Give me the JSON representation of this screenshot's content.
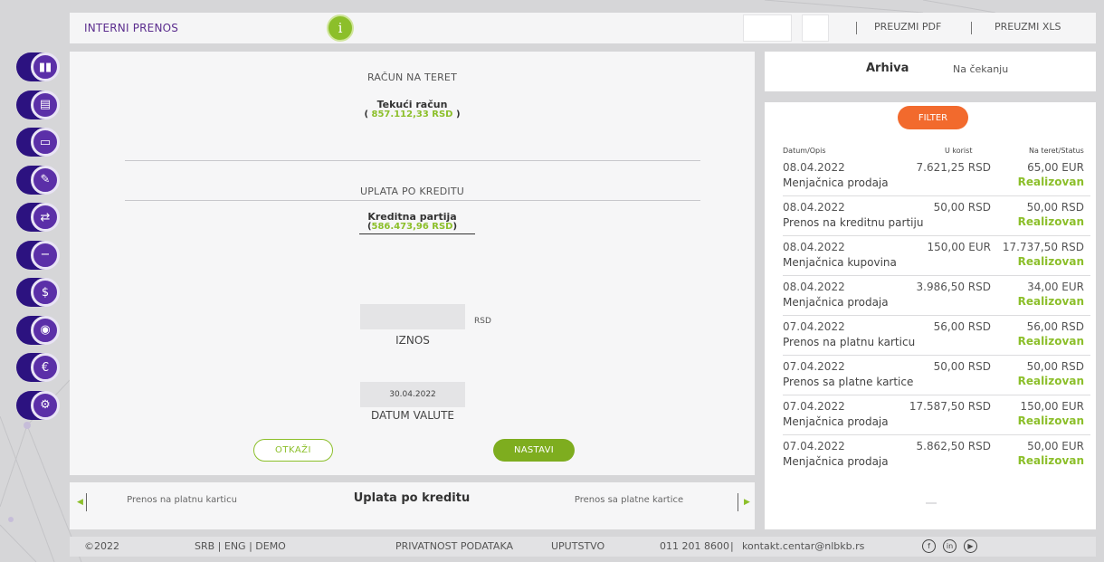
{
  "header": {
    "title": "INTERNI PRENOS",
    "info_icon": "i",
    "download_pdf": "PREUZMI PDF",
    "download_xls": "PREUZMI XLS"
  },
  "sidebar": {
    "items": [
      {
        "icon": "chart-icon",
        "glyph": "▮▮"
      },
      {
        "icon": "document-icon",
        "glyph": "▤"
      },
      {
        "icon": "card-icon",
        "glyph": "▭"
      },
      {
        "icon": "signature-icon",
        "glyph": "✎"
      },
      {
        "icon": "transfer-icon",
        "glyph": "⇄"
      },
      {
        "icon": "minus-icon",
        "glyph": "−"
      },
      {
        "icon": "dollar-icon",
        "glyph": "$"
      },
      {
        "icon": "location-icon",
        "glyph": "◉"
      },
      {
        "icon": "euro-icon",
        "glyph": "€"
      },
      {
        "icon": "gear-icon",
        "glyph": "⚙"
      }
    ]
  },
  "form": {
    "debit_label": "RAČUN NA TERET",
    "debit_account_name": "Tekući račun",
    "debit_account_amount": "857.112,33 RSD",
    "payment_label": "UPLATA PO KREDITU",
    "credit_account_name": "Kreditna partija",
    "credit_account_amount": "586.473,96 RSD",
    "amount_value": "",
    "amount_currency": "RSD",
    "amount_label": "IZNOS",
    "date_value": "30.04.2022",
    "date_label": "DATUM VALUTE",
    "cancel_label": "OTKAŽI",
    "continue_label": "NASTAVI"
  },
  "carousel": {
    "prev": "Prenos na platnu karticu",
    "current": "Uplata po kreditu",
    "next": "Prenos sa platne kartice"
  },
  "archive": {
    "tabs": [
      "Arhiva",
      "Na čekanju"
    ],
    "filter_label": "FILTER",
    "columns": [
      "Datum/Opis",
      "U korist",
      "Na teret/Status"
    ],
    "rows": [
      {
        "date": "08.04.2022",
        "desc": "Menjačnica prodaja",
        "credit": "7.621,25 RSD",
        "debit": "65,00 EUR",
        "status": "Realizovan"
      },
      {
        "date": "08.04.2022",
        "desc": "Prenos na kreditnu partiju",
        "credit": "50,00 RSD",
        "debit": "50,00 RSD",
        "status": "Realizovan"
      },
      {
        "date": "08.04.2022",
        "desc": "Menjačnica kupovina",
        "credit": "150,00 EUR",
        "debit": "17.737,50 RSD",
        "status": "Realizovan"
      },
      {
        "date": "08.04.2022",
        "desc": "Menjačnica prodaja",
        "credit": "3.986,50 RSD",
        "debit": "34,00 EUR",
        "status": "Realizovan"
      },
      {
        "date": "07.04.2022",
        "desc": "Prenos na platnu karticu",
        "credit": "56,00 RSD",
        "debit": "56,00 RSD",
        "status": "Realizovan"
      },
      {
        "date": "07.04.2022",
        "desc": "Prenos sa platne kartice",
        "credit": "50,00 RSD",
        "debit": "50,00 RSD",
        "status": "Realizovan"
      },
      {
        "date": "07.04.2022",
        "desc": "Menjačnica prodaja",
        "credit": "17.587,50 RSD",
        "debit": "150,00 EUR",
        "status": "Realizovan"
      },
      {
        "date": "07.04.2022",
        "desc": "Menjačnica prodaja",
        "credit": "5.862,50 RSD",
        "debit": "50,00 EUR",
        "status": "Realizovan"
      }
    ]
  },
  "footer": {
    "copyright": "©2022",
    "lang": "SRB | ENG | DEMO",
    "privacy": "PRIVATNOST PODATAKA",
    "guide": "UPUTSTVO",
    "phone": "011 201 8600",
    "email": "kontakt.centar@nlbkb.rs",
    "social": [
      {
        "icon": "facebook-icon",
        "glyph": "f"
      },
      {
        "icon": "linkedin-icon",
        "glyph": "in"
      },
      {
        "icon": "youtube-icon",
        "glyph": "▶"
      }
    ]
  },
  "colors": {
    "accent_green": "#8cbf2a",
    "brand_purple": "#5b2fa8",
    "filter_orange": "#f26a2d"
  }
}
